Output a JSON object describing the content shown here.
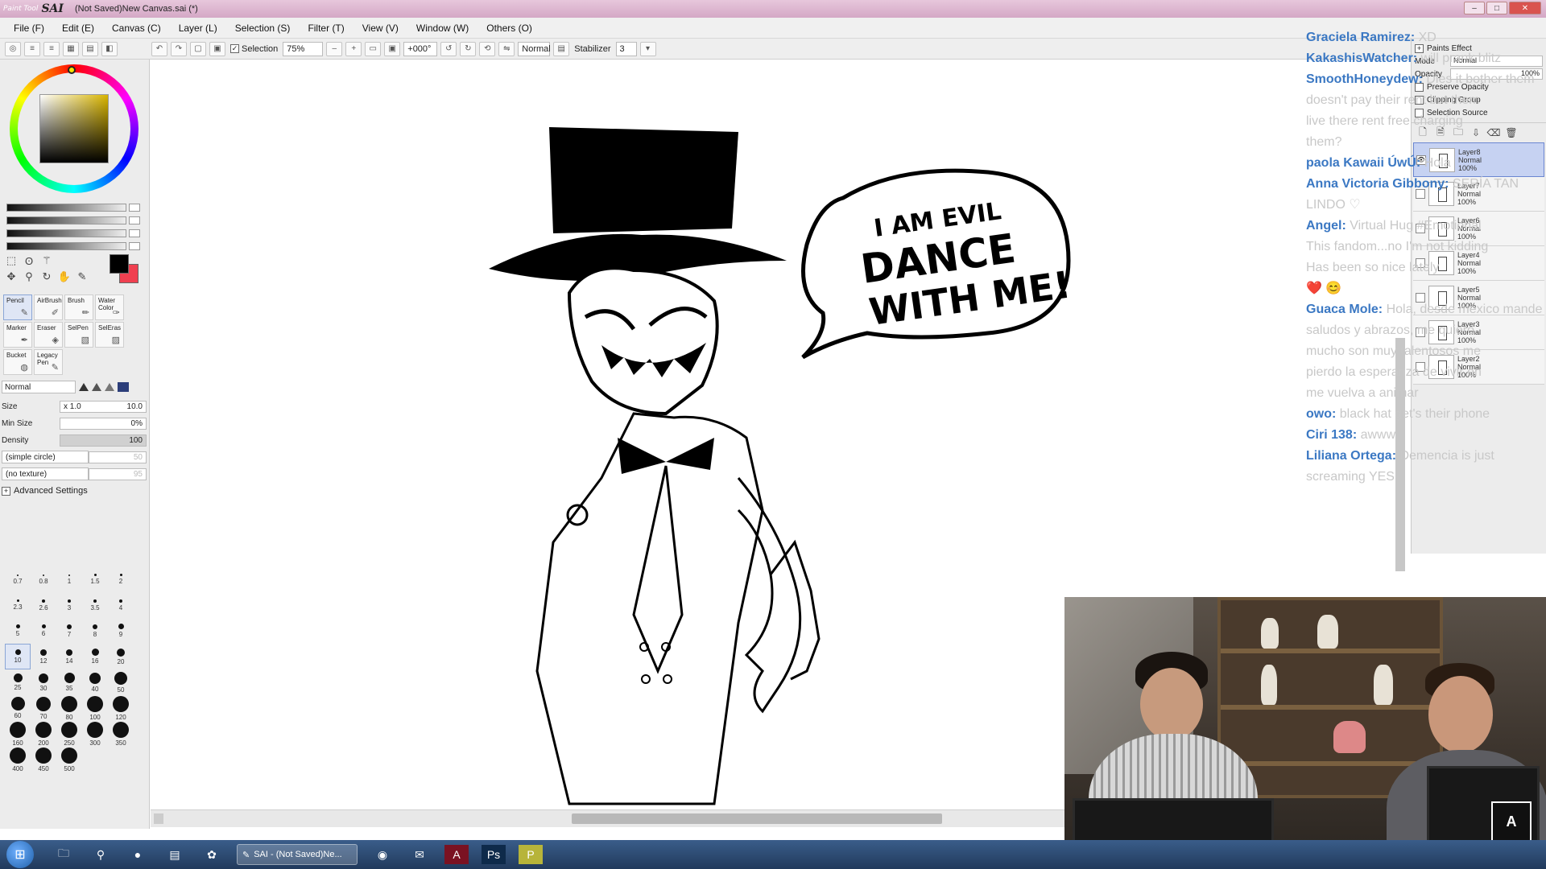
{
  "window": {
    "app_name": "SAI",
    "app_subtitle": "Paint Tool",
    "title": "(Not Saved)New Canvas.sai (*)",
    "controls": {
      "minimize": "–",
      "maximize": "□",
      "close": "✕"
    }
  },
  "menu": [
    "File (F)",
    "Edit (E)",
    "Canvas (C)",
    "Layer (L)",
    "Selection (S)",
    "Filter (T)",
    "View (V)",
    "Window (W)",
    "Others (O)"
  ],
  "toolbar": {
    "selection_label": "Selection",
    "zoom": "75%",
    "rotation": "+000°",
    "blend_mode": "Normal",
    "stabilizer_label": "Stabilizer",
    "stabilizer_value": "3"
  },
  "colors": {
    "foreground": "#000000",
    "background": "#f04050",
    "accent_username": "#3b78c3"
  },
  "tools": {
    "brushes": [
      {
        "label": "Pencil",
        "icon": "pencil-icon"
      },
      {
        "label": "AirBrush",
        "icon": "airbrush-icon"
      },
      {
        "label": "Brush",
        "icon": "brush-icon"
      },
      {
        "label": "Water Color",
        "icon": "watercolor-icon"
      },
      {
        "label": "Marker",
        "icon": "marker-icon"
      },
      {
        "label": "Eraser",
        "icon": "eraser-icon"
      },
      {
        "label": "SelPen",
        "icon": "selpen-icon"
      },
      {
        "label": "SelEras",
        "icon": "seleras-icon"
      },
      {
        "label": "Bucket",
        "icon": "bucket-icon"
      },
      {
        "label": "Legacy Pen",
        "icon": "legacy-pen-icon"
      }
    ],
    "mode": "Normal",
    "size_label": "Size",
    "size_multiplier": "x 1.0",
    "size_value": "10.0",
    "min_size_label": "Min Size",
    "min_size_value": "0%",
    "density_label": "Density",
    "density_value": "100",
    "shape": "(simple circle)",
    "shape_value": "50",
    "texture": "(no texture)",
    "texture_value": "95",
    "advanced_label": "Advanced Settings",
    "sizes": [
      "0.7",
      "0.8",
      "1",
      "1.5",
      "2",
      "2.3",
      "2.6",
      "3",
      "3.5",
      "4",
      "5",
      "6",
      "7",
      "8",
      "9",
      "10",
      "12",
      "14",
      "16",
      "20",
      "25",
      "30",
      "35",
      "40",
      "50",
      "60",
      "70",
      "80",
      "100",
      "120",
      "160",
      "200",
      "250",
      "300",
      "350",
      "400",
      "450",
      "500"
    ],
    "active_size": "10"
  },
  "chat": [
    {
      "user": "Graciela Ramirez:",
      "msg": " XD"
    },
    {
      "user": "KakashisWatcher:",
      "msg": " will prank blitz"
    },
    {
      "user": "SmoothHoneydew:",
      "msg": " Dies it bother them"
    },
    {
      "user": "",
      "msg": "doesn't pay their rent but them"
    },
    {
      "user": "",
      "msg": "live there rent free charging"
    },
    {
      "user": "",
      "msg": "them?"
    },
    {
      "user": "paola Kawaii ÚwÚ:",
      "msg": " Hola"
    },
    {
      "user": "Anna Victoria Gibbony:",
      "msg": " SERÍA TAN"
    },
    {
      "user": "",
      "msg": "LINDO ♡"
    },
    {
      "user": "Angel:",
      "msg": " Virtual Hug #Emotional"
    },
    {
      "user": "",
      "msg": "This fandom...no I'm not kidding"
    },
    {
      "user": "",
      "msg": "Has been so nice lately"
    },
    {
      "user": "",
      "msg": "❤️ 😊"
    },
    {
      "user": "Guaca Mole:",
      "msg": " Hola, desde mexico mande"
    },
    {
      "user": "",
      "msg": "saludos y abrazos, me quiero"
    },
    {
      "user": "",
      "msg": "mucho son muy talentosos me"
    },
    {
      "user": "",
      "msg": "pierdo la esperanza de vivir en"
    },
    {
      "user": "",
      "msg": "me vuelva a animar"
    },
    {
      "user": "owo:",
      "msg": " black hat get's their phone"
    },
    {
      "user": "Ciri 138:",
      "msg": " awww"
    },
    {
      "user": "Liliana Ortega:",
      "msg": " Demencia is just"
    },
    {
      "user": "",
      "msg": "screaming YES"
    }
  ],
  "layers_panel": {
    "paints_effect": "Paints Effect",
    "mode_label": "Mode",
    "mode_value": "Normal",
    "opacity_label": "Opacity",
    "opacity_value": "100%",
    "preserve_opacity": "Preserve Opacity",
    "clipping_group": "Clipping Group",
    "selection_source": "Selection Source",
    "layers": [
      {
        "name": "Layer8",
        "mode": "Normal",
        "opacity": "100%",
        "active": true
      },
      {
        "name": "Layer7",
        "mode": "Normal",
        "opacity": "100%",
        "active": false
      },
      {
        "name": "Layer6",
        "mode": "Normal",
        "opacity": "100%",
        "active": false
      },
      {
        "name": "Layer4",
        "mode": "Normal",
        "opacity": "100%",
        "active": false
      },
      {
        "name": "Layer5",
        "mode": "Normal",
        "opacity": "100%",
        "active": false
      },
      {
        "name": "Layer3",
        "mode": "Normal",
        "opacity": "100%",
        "active": false
      },
      {
        "name": "Layer2",
        "mode": "Normal",
        "opacity": "100%",
        "active": false
      }
    ]
  },
  "drawing": {
    "speech_line1": "I AM EVIL",
    "speech_line2": "DANCE",
    "speech_line3": "WITH ME!"
  },
  "webcam": {
    "logo_text": "A"
  },
  "taskbar": {
    "start_icon": "windows-start-icon",
    "pinned": [
      "file-explorer-icon",
      "search-icon",
      "spotify-icon",
      "notepad-icon",
      "paint-icon"
    ],
    "active_task": "SAI - (Not Saved)Ne...",
    "more": [
      "chrome-icon",
      "outlook-icon",
      "adobe-icon",
      "photoshop-icon",
      "app-icon"
    ]
  }
}
